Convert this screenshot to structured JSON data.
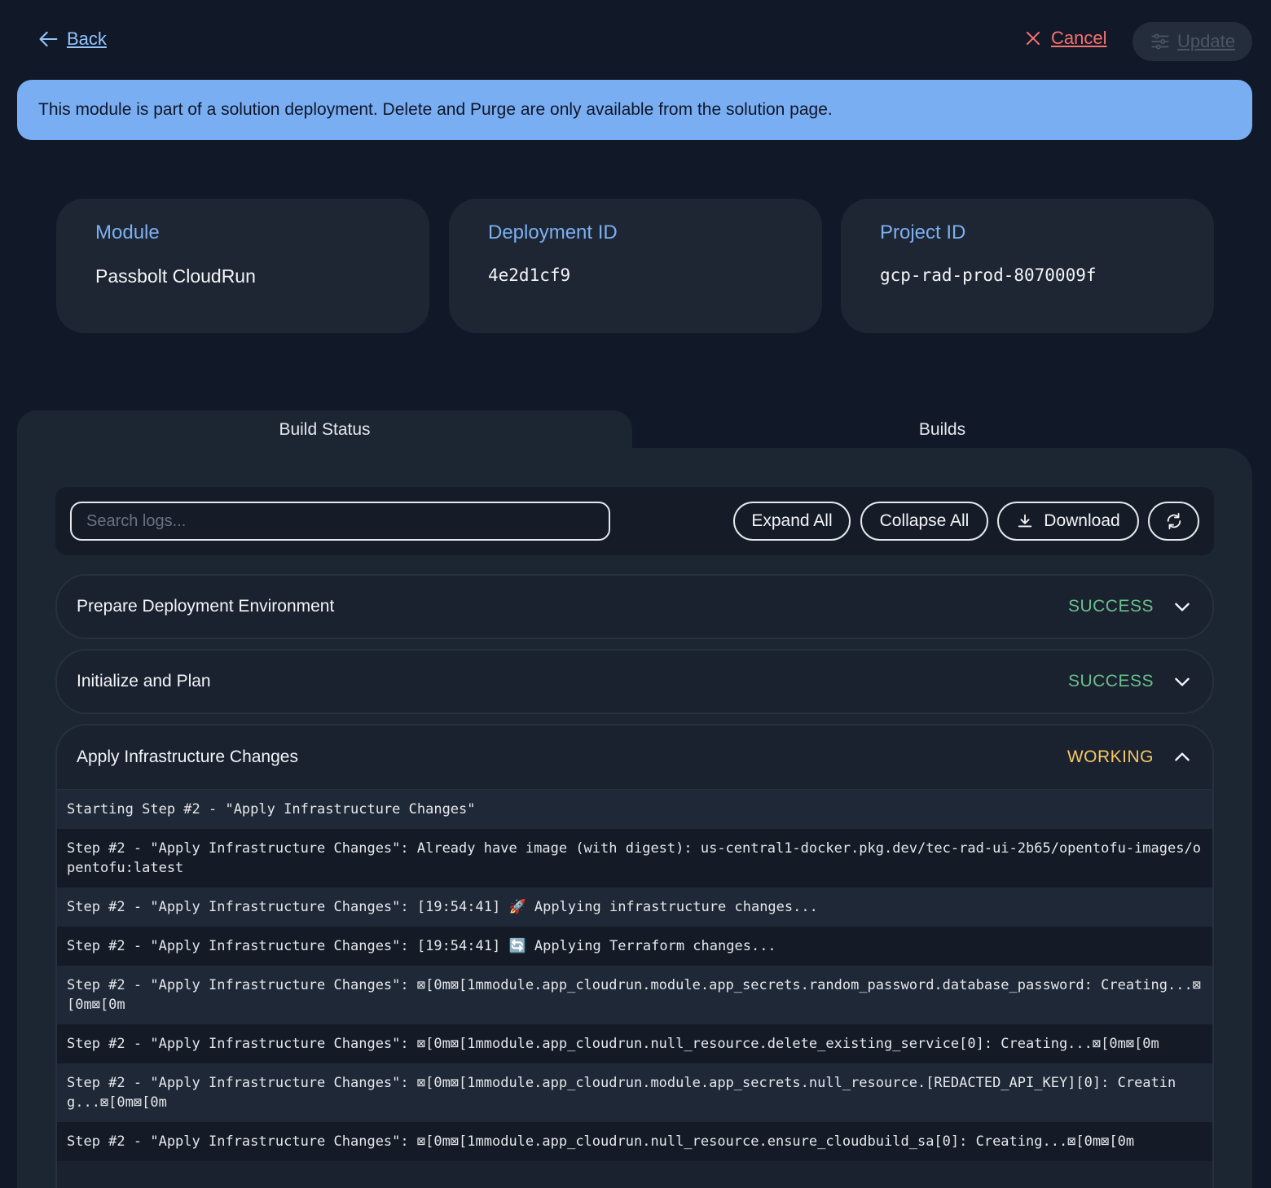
{
  "nav": {
    "back_label": "Back",
    "cancel_label": "Cancel",
    "update_label": "Update"
  },
  "banner": {
    "text": "This module is part of a solution deployment. Delete and Purge are only available from the solution page."
  },
  "cards": [
    {
      "label": "Module",
      "value": "Passbolt CloudRun"
    },
    {
      "label": "Deployment ID",
      "value": "4e2d1cf9"
    },
    {
      "label": "Project ID",
      "value": "gcp-rad-prod-8070009f"
    }
  ],
  "tabs": [
    {
      "label": "Build Status",
      "active": true
    },
    {
      "label": "Builds",
      "active": false
    }
  ],
  "toolbar": {
    "search_placeholder": "Search logs...",
    "expand_all": "Expand All",
    "collapse_all": "Collapse All",
    "download": "Download"
  },
  "steps": [
    {
      "title": "Prepare Deployment Environment",
      "status": "SUCCESS",
      "expanded": false
    },
    {
      "title": "Initialize and Plan",
      "status": "SUCCESS",
      "expanded": false
    },
    {
      "title": "Apply Infrastructure Changes",
      "status": "WORKING",
      "expanded": true
    }
  ],
  "logs": [
    "Starting Step #2 - \"Apply Infrastructure Changes\"",
    "Step #2 - \"Apply Infrastructure Changes\": Already have image (with digest): us-central1-docker.pkg.dev/tec-rad-ui-2b65/opentofu-images/opentofu:latest",
    "Step #2 - \"Apply Infrastructure Changes\": [19:54:41] 🚀 Applying infrastructure changes...",
    "Step #2 - \"Apply Infrastructure Changes\": [19:54:41] 🔄 Applying Terraform changes...",
    "Step #2 - \"Apply Infrastructure Changes\": ⊠[0m⊠[1mmodule.app_cloudrun.module.app_secrets.random_password.database_password: Creating...⊠[0m⊠[0m",
    "Step #2 - \"Apply Infrastructure Changes\": ⊠[0m⊠[1mmodule.app_cloudrun.null_resource.delete_existing_service[0]: Creating...⊠[0m⊠[0m",
    "Step #2 - \"Apply Infrastructure Changes\": ⊠[0m⊠[1mmodule.app_cloudrun.module.app_secrets.null_resource.[REDACTED_API_KEY][0]: Creating...⊠[0m⊠[0m",
    "Step #2 - \"Apply Infrastructure Changes\": ⊠[0m⊠[1mmodule.app_cloudrun.null_resource.ensure_cloudbuild_sa[0]: Creating...⊠[0m⊠[0m"
  ],
  "colors": {
    "background": "#111827",
    "banner": "#7aaef2",
    "label_blue": "#7cb0f2",
    "success": "#6bbf8a",
    "working": "#f6c762",
    "cancel": "#f87171"
  }
}
